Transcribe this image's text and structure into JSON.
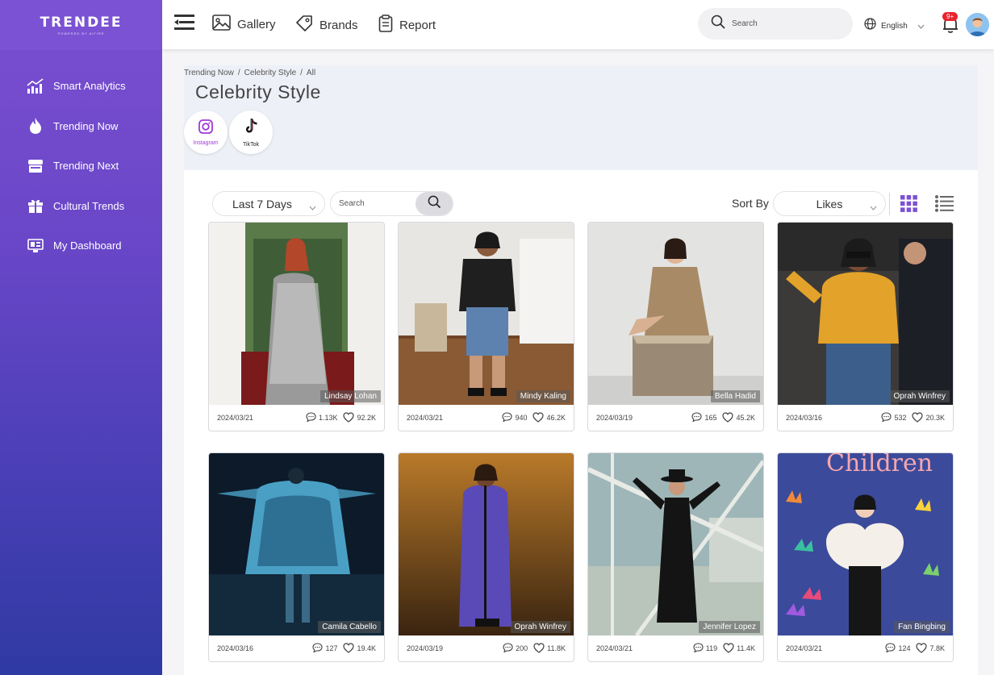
{
  "brand": {
    "logo": "TRENDEE",
    "tagline": "POWERED BY AIFIRE"
  },
  "sidebar": {
    "items": [
      {
        "label": "Smart Analytics",
        "icon": "analytics-icon"
      },
      {
        "label": "Trending Now",
        "icon": "flame-icon"
      },
      {
        "label": "Trending Next",
        "icon": "store-icon"
      },
      {
        "label": "Cultural Trends",
        "icon": "gift-icon"
      },
      {
        "label": "My Dashboard",
        "icon": "dashboard-icon"
      }
    ]
  },
  "topbar": {
    "tabs": [
      {
        "label": "Gallery",
        "icon": "gallery-icon"
      },
      {
        "label": "Brands",
        "icon": "tag-icon"
      },
      {
        "label": "Report",
        "icon": "clipboard-icon"
      }
    ],
    "search_placeholder": "Search",
    "language": "English",
    "notification_count": "9+"
  },
  "breadcrumb": [
    "Trending Now",
    "Celebrity Style",
    "All"
  ],
  "page_title": "Celebrity Style",
  "platforms": [
    {
      "label": "Instagram",
      "icon": "instagram-icon"
    },
    {
      "label": "TikTok",
      "icon": "tiktok-icon"
    }
  ],
  "filters": {
    "time_range": "Last 7 Days",
    "search_placeholder": "Search",
    "sort_label": "Sort By",
    "sort_value": "Likes"
  },
  "colors": {
    "accent": "#7b52d3",
    "sidebar_bottom": "#2f3aa3"
  },
  "cards": [
    {
      "name": "Lindsay Lohan",
      "date": "2024/03/21",
      "comments": "1.13K",
      "likes": "92.2K"
    },
    {
      "name": "Mindy Kaling",
      "date": "2024/03/21",
      "comments": "940",
      "likes": "46.2K"
    },
    {
      "name": "Bella Hadid",
      "date": "2024/03/19",
      "comments": "165",
      "likes": "45.2K"
    },
    {
      "name": "Oprah Winfrey",
      "date": "2024/03/16",
      "comments": "532",
      "likes": "20.3K"
    },
    {
      "name": "Camila Cabello",
      "date": "2024/03/16",
      "comments": "127",
      "likes": "19.4K"
    },
    {
      "name": "Oprah Winfrey",
      "date": "2024/03/19",
      "comments": "200",
      "likes": "11.8K"
    },
    {
      "name": "Jennifer Lopez",
      "date": "2024/03/21",
      "comments": "119",
      "likes": "11.4K"
    },
    {
      "name": "Fan Bingbing",
      "date": "2024/03/21",
      "comments": "124",
      "likes": "7.8K"
    }
  ]
}
